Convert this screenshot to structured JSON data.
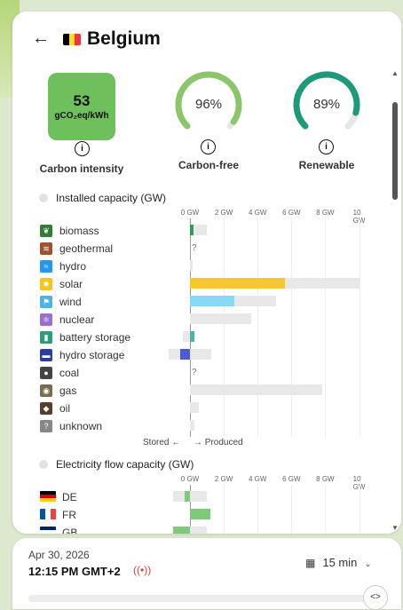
{
  "zone": {
    "name": "Belgium",
    "flag_colors": [
      "#000000",
      "#FDDA24",
      "#EF3340"
    ]
  },
  "metrics": {
    "carbon_intensity": {
      "value": "53",
      "unit": "gCO₂eq/kWh",
      "label": "Carbon intensity",
      "color": "#6fbf5d"
    },
    "carbon_free": {
      "value": "96%",
      "label": "Carbon-free",
      "fraction": 0.96,
      "color": "#8bc66a"
    },
    "renewable": {
      "value": "89%",
      "label": "Renewable",
      "fraction": 0.89,
      "color": "#1d9a7a"
    }
  },
  "installed": {
    "title": "Installed capacity (GW)",
    "axis_ticks": [
      "0 GW",
      "2 GW",
      "4 GW",
      "6 GW",
      "8 GW",
      "10 GW"
    ],
    "rows": [
      {
        "label": "biomass",
        "icon": "leaf-icon",
        "icon_color": "#2e7d32",
        "produced": 0.2,
        "capacity": 1.0,
        "bar_color": "#2e9e5a"
      },
      {
        "label": "geothermal",
        "icon": "heat-icon",
        "icon_color": "#a0522d",
        "unknown": "?"
      },
      {
        "label": "hydro",
        "icon": "wave-icon",
        "icon_color": "#2196f3",
        "produced": 0,
        "capacity": 0.15,
        "bar_color": "#2196f3"
      },
      {
        "label": "solar",
        "icon": "sun-icon",
        "icon_color": "#f5c518",
        "produced": 5.6,
        "capacity": 10.0,
        "bar_color": "#f5c92e"
      },
      {
        "label": "wind",
        "icon": "wind-icon",
        "icon_color": "#4fb3e8",
        "produced": 2.65,
        "capacity": 5.1,
        "bar_color": "#86d9f5"
      },
      {
        "label": "nuclear",
        "icon": "atom-icon",
        "icon_color": "#9b6fd1",
        "produced": 0,
        "capacity": 3.6,
        "bar_color": "#9b6fd1"
      },
      {
        "label": "battery storage",
        "icon": "battery-icon",
        "icon_color": "#2e9e7a",
        "produced": 0.25,
        "capacity": 0.25,
        "stored_capacity": 0.4,
        "bar_color": "#4db6a0"
      },
      {
        "label": "hydro storage",
        "icon": "dam-icon",
        "icon_color": "#2c3ea3",
        "stored": 0.6,
        "stored_capacity": 1.25,
        "capacity": 1.25,
        "bar_color": "#4a5bd4"
      },
      {
        "label": "coal",
        "icon": "coal-icon",
        "icon_color": "#444444",
        "unknown": "?"
      },
      {
        "label": "gas",
        "icon": "gas-icon",
        "icon_color": "#7a6a4f",
        "produced": 0,
        "capacity": 7.8,
        "bar_color": "#888888"
      },
      {
        "label": "oil",
        "icon": "oil-icon",
        "icon_color": "#5a3d2b",
        "produced": 0,
        "capacity": 0.5,
        "bar_color": "#888888"
      },
      {
        "label": "unknown",
        "icon": "question-icon",
        "icon_color": "#888888",
        "produced": 0,
        "capacity": 0.25,
        "bar_color": "#888888"
      }
    ],
    "stored_label": "Stored ←",
    "produced_label": "→ Produced"
  },
  "flows": {
    "title": "Electricity flow capacity (GW)",
    "axis_ticks": [
      "0 GW",
      "2 GW",
      "4 GW",
      "6 GW",
      "8 GW",
      "10 GW"
    ],
    "rows": [
      {
        "label": "DE",
        "flag": "de",
        "stored": 0.3,
        "stored_capacity": 1.0,
        "capacity": 1.0,
        "bar_color": "#7fc97a"
      },
      {
        "label": "FR",
        "flag": "fr",
        "produced": 1.2,
        "capacity": 1.2,
        "bar_color": "#7fc97a"
      },
      {
        "label": "GB",
        "flag": "gb",
        "stored": 1.0,
        "stored_capacity": 1.0,
        "capacity": 1.0,
        "bar_color": "#7fc97a"
      }
    ]
  },
  "footer": {
    "date": "Apr 30, 2026",
    "time": "12:15 PM GMT+2",
    "resolution": "15 min"
  }
}
